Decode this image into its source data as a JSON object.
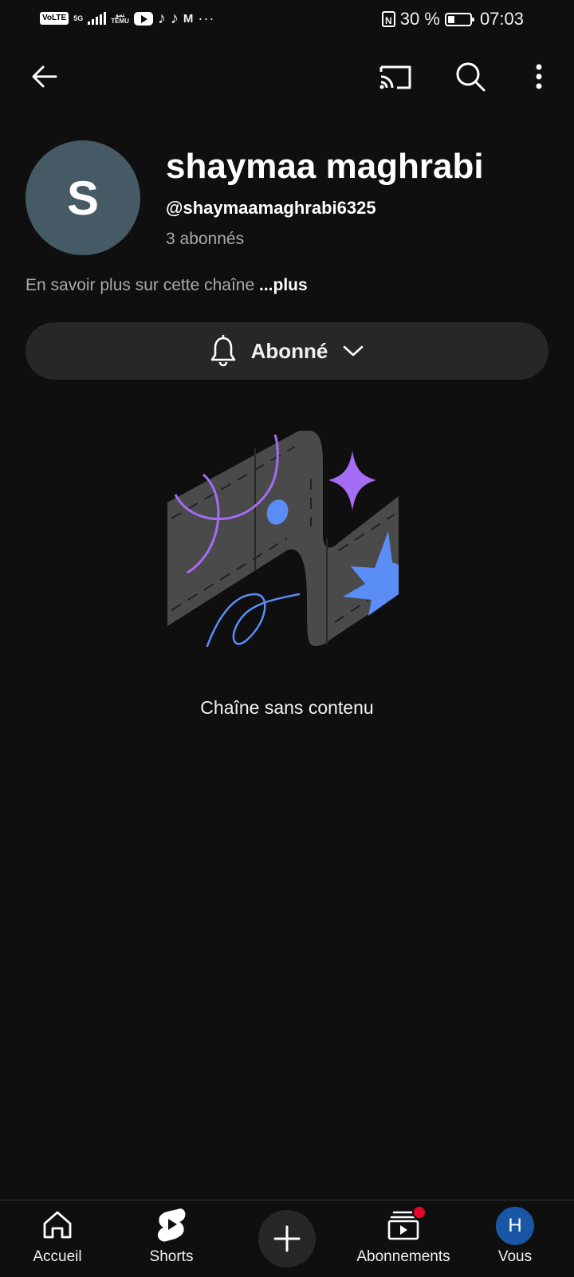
{
  "status_bar": {
    "volte": "VoLTE",
    "network": "5G",
    "carrier_small": "TEMU",
    "carrier_top": "ﻨﻤﻮ",
    "misc_app": "M",
    "more": "···",
    "nfc": "N",
    "battery_text": "30 %",
    "battery_level": 0.3,
    "time": "07:03"
  },
  "toolbar": {
    "back_icon": "arrow-left-icon",
    "cast_icon": "cast-icon",
    "search_icon": "search-icon",
    "more_icon": "more-vertical-icon"
  },
  "channel": {
    "avatar_letter": "S",
    "avatar_color": "#455a64",
    "name": "shaymaa maghrabi",
    "handle": "@shaymaamaghrabi6325",
    "subscribers": "3 abonnés",
    "about": "En savoir plus sur cette chaîne",
    "about_more": "...plus"
  },
  "subscribe_button": {
    "label": "Abonné",
    "bell_icon": "bell-icon",
    "chevron_icon": "chevron-down-icon"
  },
  "empty_state": {
    "text": "Chaîne sans contenu"
  },
  "bottom_nav": {
    "items": [
      {
        "label": "Accueil",
        "icon": "home-icon"
      },
      {
        "label": "Shorts",
        "icon": "shorts-icon"
      },
      {
        "label": "",
        "icon": "plus-icon"
      },
      {
        "label": "Abonnements",
        "icon": "subscriptions-icon"
      },
      {
        "label": "Vous",
        "icon": "account-avatar",
        "avatar_letter": "H"
      }
    ],
    "accent_red": "#e5082b",
    "you_avatar_color": "#1a56a6"
  }
}
